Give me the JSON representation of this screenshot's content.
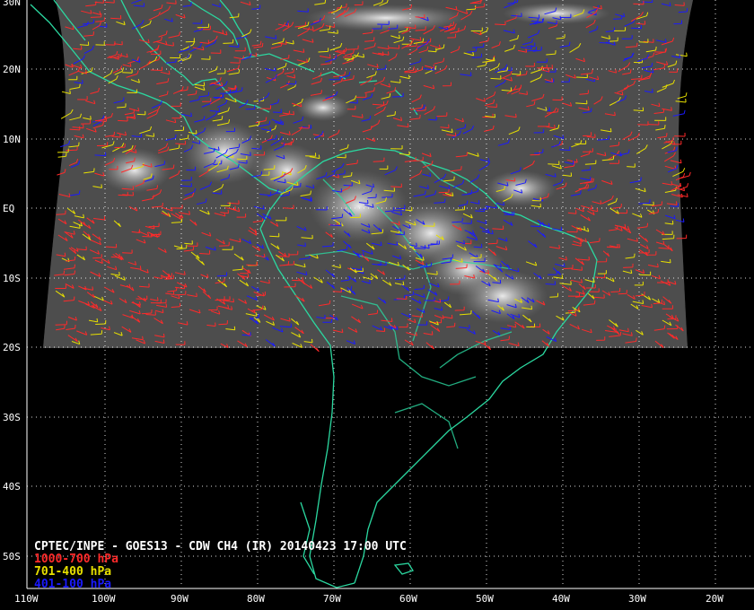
{
  "title": "CPTEC/INPE - GOES13 - CDW CH4 (IR) 20140423 17:00 UTC",
  "legend": [
    {
      "label": "1000-700 hPa",
      "color": "#ff2a2a"
    },
    {
      "label": "701-400 hPa",
      "color": "#e8e000"
    },
    {
      "label": "401-100 hPa",
      "color": "#1a1aff"
    }
  ],
  "lat_labels": [
    "30N",
    "20N",
    "10N",
    "EQ",
    "10S",
    "20S",
    "30S",
    "40S",
    "50S"
  ],
  "lon_labels": [
    "110W",
    "100W",
    "90W",
    "80W",
    "70W",
    "60W",
    "50W",
    "40W",
    "30W",
    "20W"
  ],
  "colors": {
    "background": "#000000",
    "coastline": "#2bd8a0",
    "grid": "#ffffff",
    "satellite_gray": "#5a5a5a"
  }
}
